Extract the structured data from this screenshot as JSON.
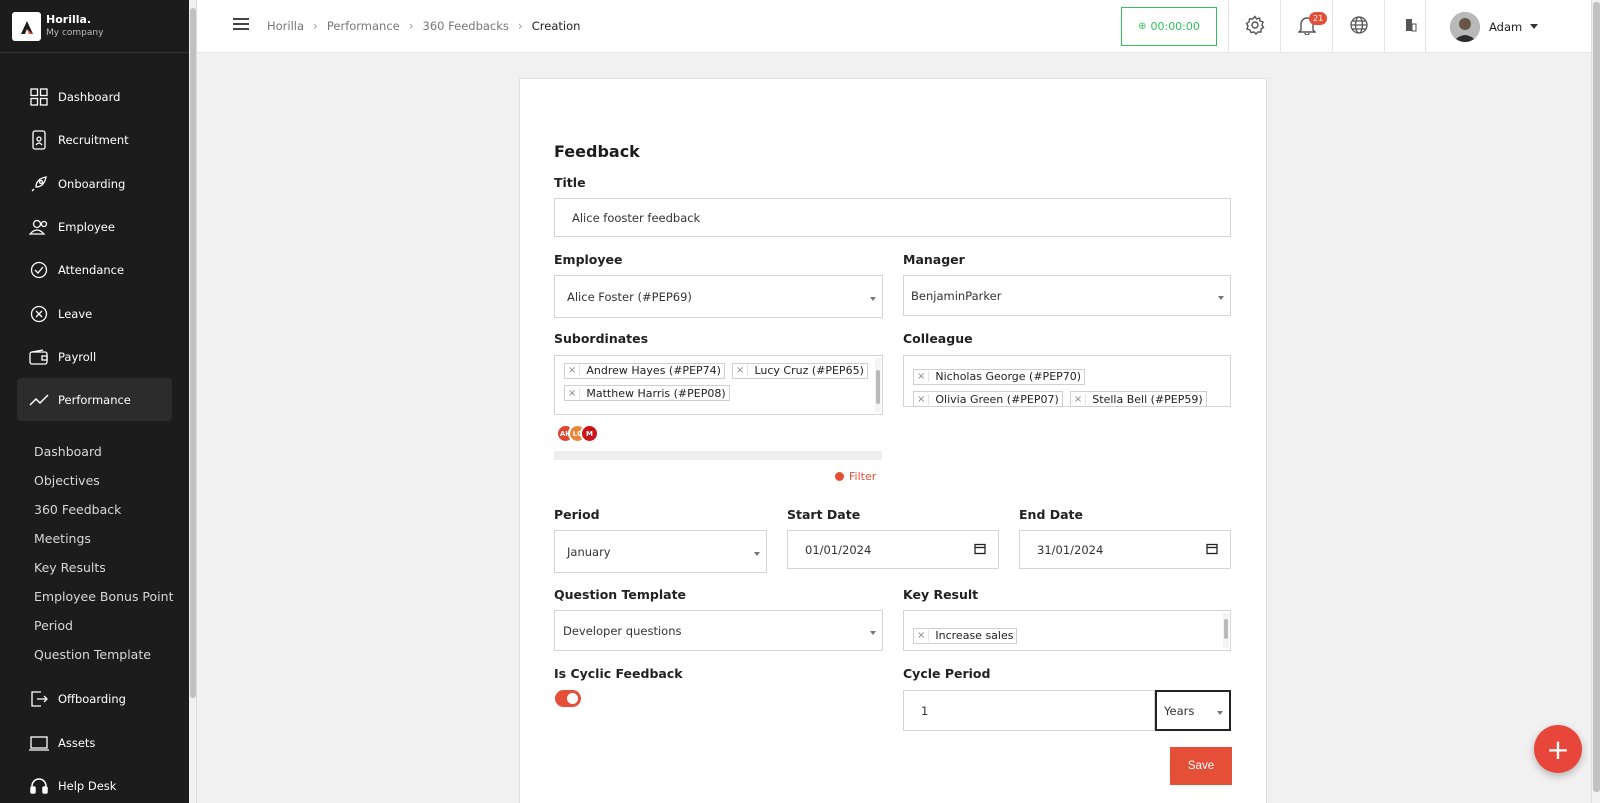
{
  "brand": {
    "name": "Horilla.",
    "company": "My company"
  },
  "sidebar": {
    "items": [
      {
        "label": "Dashboard",
        "icon": "dashboard-icon"
      },
      {
        "label": "Recruitment",
        "icon": "recruitment-icon"
      },
      {
        "label": "Onboarding",
        "icon": "rocket-icon"
      },
      {
        "label": "Employee",
        "icon": "users-icon"
      },
      {
        "label": "Attendance",
        "icon": "check-circle-icon"
      },
      {
        "label": "Leave",
        "icon": "x-circle-icon"
      },
      {
        "label": "Payroll",
        "icon": "wallet-icon"
      },
      {
        "label": "Performance",
        "icon": "trend-icon"
      },
      {
        "label": "Offboarding",
        "icon": "exit-icon"
      },
      {
        "label": "Assets",
        "icon": "laptop-icon"
      },
      {
        "label": "Help Desk",
        "icon": "headset-icon"
      }
    ],
    "performance_sub": [
      "Dashboard",
      "Objectives",
      "360 Feedback",
      "Meetings",
      "Key Results",
      "Employee Bonus Point",
      "Period",
      "Question Template"
    ]
  },
  "topbar": {
    "breadcrumbs": [
      "Horilla",
      "Performance",
      "360 Feedbacks"
    ],
    "breadcrumb_current": "Creation",
    "timer": "00:00:00",
    "notification_count": "21",
    "user_name": "Adam"
  },
  "form": {
    "heading": "Feedback",
    "title_label": "Title",
    "title_value": "Alice fooster feedback",
    "employee_label": "Employee",
    "employee_value": "Alice Foster (#PEP69)",
    "manager_label": "Manager",
    "manager_value": "BenjaminParker",
    "subordinates_label": "Subordinates",
    "subordinates": [
      "Andrew Hayes (#PEP74)",
      "Lucy Cruz (#PEP65)",
      "Matthew Harris (#PEP08)"
    ],
    "subordinate_avatars": [
      {
        "initials": "AH",
        "color": "#e0452f"
      },
      {
        "initials": "LC",
        "color": "#e8873a"
      },
      {
        "initials": "M",
        "color": "#c9141b"
      }
    ],
    "colleague_label": "Colleague",
    "colleagues": [
      "Nicholas George (#PEP70)",
      "Olivia Green (#PEP07)",
      "Stella Bell (#PEP59)"
    ],
    "filter_label": "Filter",
    "period_label": "Period",
    "period_value": "January",
    "start_date_label": "Start Date",
    "start_date_value": "01/01/2024",
    "end_date_label": "End Date",
    "end_date_value": "31/01/2024",
    "question_template_label": "Question Template",
    "question_template_value": "Developer questions",
    "key_result_label": "Key Result",
    "key_results": [
      "Increase sales"
    ],
    "cyclic_label": "Is Cyclic Feedback",
    "cyclic_on": true,
    "cycle_period_label": "Cycle Period",
    "cycle_period_value": "1",
    "cycle_unit": "Years",
    "save_label": "Save"
  },
  "colors": {
    "accent": "#e54f38",
    "sidebar_bg": "#1c1c1c",
    "timer_green": "#2fbf5b"
  }
}
